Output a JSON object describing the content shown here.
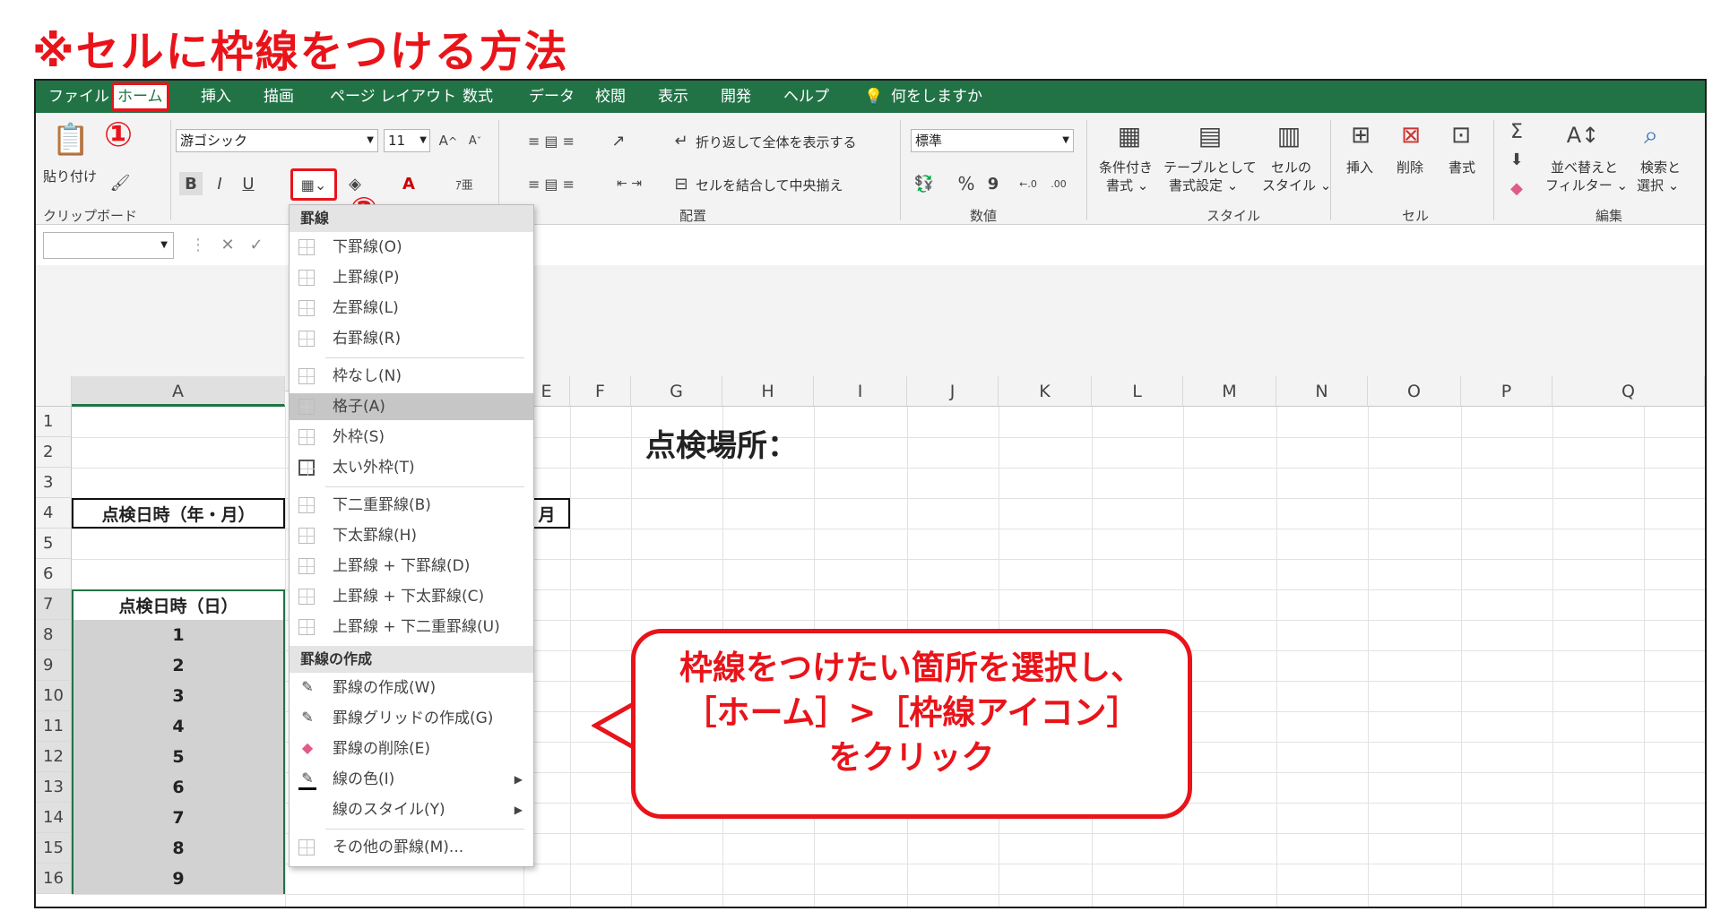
{
  "title": "※セルに枠線をつける方法",
  "menu": [
    "ファイル",
    "ホーム",
    "挿入",
    "描画",
    "ページ レイアウト",
    "数式",
    "データ",
    "校閲",
    "表示",
    "開発",
    "ヘルプ",
    "何をしますか"
  ],
  "clipboard": {
    "paste": "貼り付け",
    "group": "クリップボード",
    "marker1": "①"
  },
  "font": {
    "name": "游ゴシック",
    "size": "11",
    "bold": "B",
    "italic": "I",
    "underline": "U",
    "marker2": "②"
  },
  "alignment": {
    "wrap": "折り返して全体を表示する",
    "merge": "セルを結合して中央揃え",
    "group": "配置"
  },
  "number": {
    "format": "標準",
    "percent": "%",
    "comma": "9",
    "inc": "←.0",
    "dec": ".00",
    "group": "数値"
  },
  "styles": {
    "cond": "条件付き\n書式 ⌄",
    "cond1": "条件付き",
    "cond2": "書式 ⌄",
    "table1": "テーブルとして",
    "table2": "書式設定 ⌄",
    "cell1": "セルの",
    "cell2": "スタイル ⌄",
    "group": "スタイル"
  },
  "cells": {
    "insert": "挿入",
    "delete": "削除",
    "format": "書式",
    "group": "セル"
  },
  "editing": {
    "sort1": "並べ替えと",
    "sort2": "フィルター ⌄",
    "find1": "検索と",
    "find2": "選択 ⌄",
    "sigma": "Σ",
    "group": "編集"
  },
  "columns": [
    "A",
    "E",
    "F",
    "G",
    "H",
    "I",
    "J",
    "K",
    "L",
    "M",
    "N",
    "O",
    "P",
    "Q"
  ],
  "rows": [
    "1",
    "2",
    "3",
    "4",
    "5",
    "6",
    "7",
    "8",
    "9",
    "10",
    "11",
    "12",
    "13",
    "14",
    "15",
    "16"
  ],
  "sheet": {
    "place": "点検場所：",
    "date_ym": "点検日時（年・月）",
    "month": "月",
    "date_d": "点検日時（日）",
    "days": [
      "1",
      "2",
      "3",
      "4",
      "5",
      "6",
      "7",
      "8",
      "9"
    ]
  },
  "dropdown": {
    "header1": "罫線",
    "items1": [
      "下罫線(O)",
      "上罫線(P)",
      "左罫線(L)",
      "右罫線(R)"
    ],
    "items2": [
      "枠なし(N)",
      "格子(A)",
      "外枠(S)",
      "太い外枠(T)"
    ],
    "items3": [
      "下二重罫線(B)",
      "下太罫線(H)",
      "上罫線 + 下罫線(D)",
      "上罫線 + 下太罫線(C)",
      "上罫線 + 下二重罫線(U)"
    ],
    "header2": "罫線の作成",
    "items4": [
      "罫線の作成(W)",
      "罫線グリッドの作成(G)",
      "罫線の削除(E)",
      "線の色(I)",
      "線のスタイル(Y)"
    ],
    "more": "その他の罫線(M)..."
  },
  "callout": {
    "line1": "枠線をつけたい箇所を選択し、",
    "line2": "［ホーム］>［枠線アイコン］",
    "line3": "をクリック"
  },
  "colors": {
    "accent": "#e8141a",
    "excel_green": "#217346"
  }
}
